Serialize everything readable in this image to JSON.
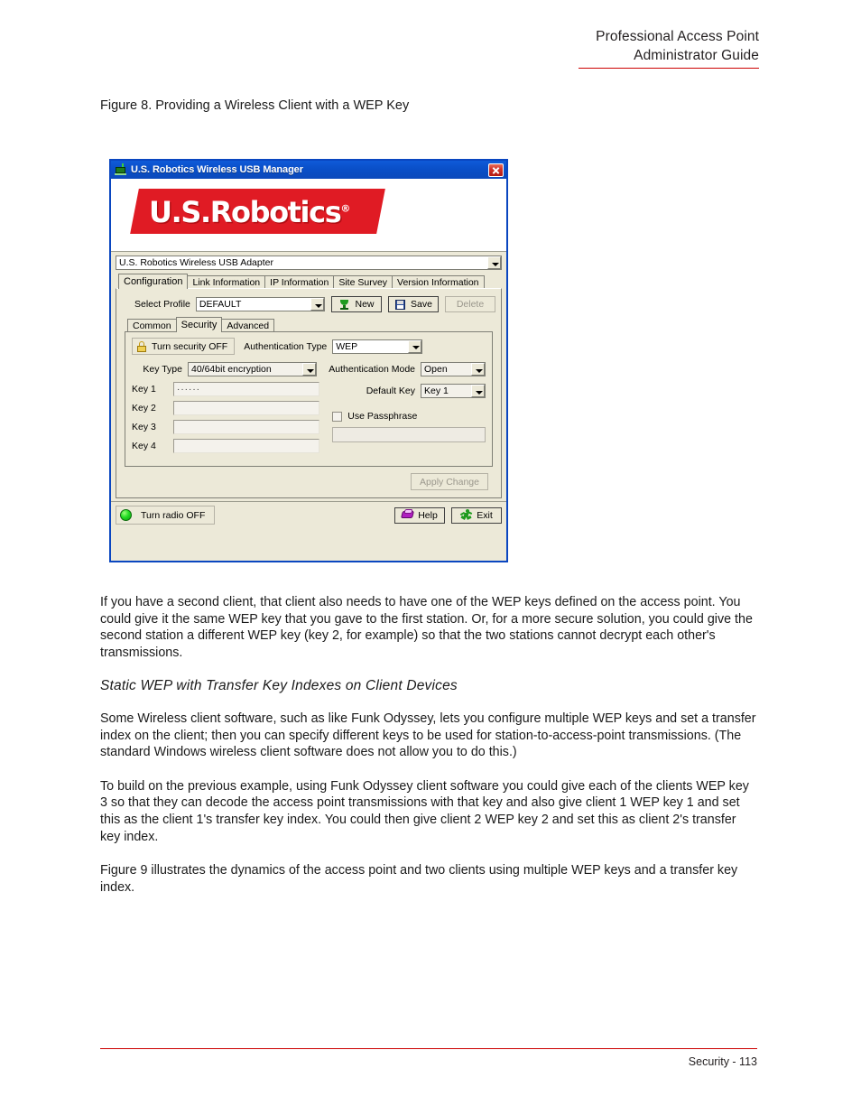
{
  "page_header": {
    "line1": "Professional Access Point",
    "line2": "Administrator Guide"
  },
  "figure_caption": "Figure 8. Providing a Wireless Client with a WEP Key",
  "dialog": {
    "title": "U.S. Robotics Wireless USB Manager",
    "title_icon": "wireless-device-icon",
    "close_icon": "close-icon",
    "logo": {
      "text": "U.S.Robotics",
      "registered_mark": "®",
      "color": "#e01b24"
    },
    "adapter_select": {
      "label": "adapter-select",
      "value": "U.S. Robotics Wireless USB Adapter"
    },
    "tabs": [
      {
        "label": "Configuration",
        "active": true
      },
      {
        "label": "Link Information",
        "active": false
      },
      {
        "label": "IP Information",
        "active": false
      },
      {
        "label": "Site Survey",
        "active": false
      },
      {
        "label": "Version Information",
        "active": false
      }
    ],
    "profile": {
      "label": "Select Profile",
      "value": "DEFAULT",
      "buttons": [
        {
          "label": "New",
          "icon": "trophy-icon",
          "disabled": false
        },
        {
          "label": "Save",
          "icon": "floppy-disk-icon",
          "disabled": false
        },
        {
          "label": "Delete",
          "icon": "",
          "disabled": true
        }
      ]
    },
    "inner_tabs": [
      {
        "label": "Common",
        "active": false
      },
      {
        "label": "Security",
        "active": true
      },
      {
        "label": "Advanced",
        "active": false
      }
    ],
    "security": {
      "security_toggle": {
        "label": "Turn security OFF",
        "icon": "padlock-icon"
      },
      "auth_type": {
        "label": "Authentication Type",
        "value": "WEP"
      },
      "key_type": {
        "label": "Key Type",
        "value": "40/64bit encryption"
      },
      "auth_mode": {
        "label": "Authentication Mode",
        "value": "Open"
      },
      "default_key": {
        "label": "Default Key",
        "value": "Key 1"
      },
      "keys": [
        {
          "label": "Key 1",
          "value": "······"
        },
        {
          "label": "Key 2",
          "value": ""
        },
        {
          "label": "Key 3",
          "value": ""
        },
        {
          "label": "Key 4",
          "value": ""
        }
      ],
      "use_passphrase": {
        "label": "Use Passphrase",
        "checked": false,
        "value": ""
      }
    },
    "apply_button": {
      "label": "Apply Change",
      "disabled": true
    },
    "bottom_bar": {
      "radio_toggle": {
        "label": "Turn radio OFF",
        "icon": "green-led-icon"
      },
      "help_button": {
        "label": "Help",
        "icon": "help-book-icon"
      },
      "exit_button": {
        "label": "Exit",
        "icon": "running-person-icon"
      }
    }
  },
  "body": {
    "p1": "If you have a second client, that client also needs to have one of the WEP keys defined on the access point. You could give it the same WEP key that you gave to the first station. Or, for a more secure solution, you could give the second station a different WEP key (key 2, for example) so that the two stations cannot decrypt each other's transmissions.",
    "heading": "Static WEP with Transfer Key Indexes on Client Devices",
    "p2": "Some Wireless client software, such as like Funk Odyssey, lets you configure multiple WEP keys and set a transfer index on the client; then you can specify different keys to be used for station-to-access-point transmissions. (The standard Windows wireless client software does not allow you to do this.)",
    "p3": "To build on the previous example, using Funk Odyssey client software you could give each of the clients WEP key 3 so that they can decode the access point transmissions with that key and also give client 1 WEP key 1 and set this as the client 1's transfer key index. You could then give client 2 WEP key 2 and set this as client 2's transfer key index.",
    "p4": "Figure 9 illustrates the dynamics of the access point and two clients using multiple WEP keys and a transfer key index."
  },
  "footer": {
    "text": "Security - 113"
  }
}
